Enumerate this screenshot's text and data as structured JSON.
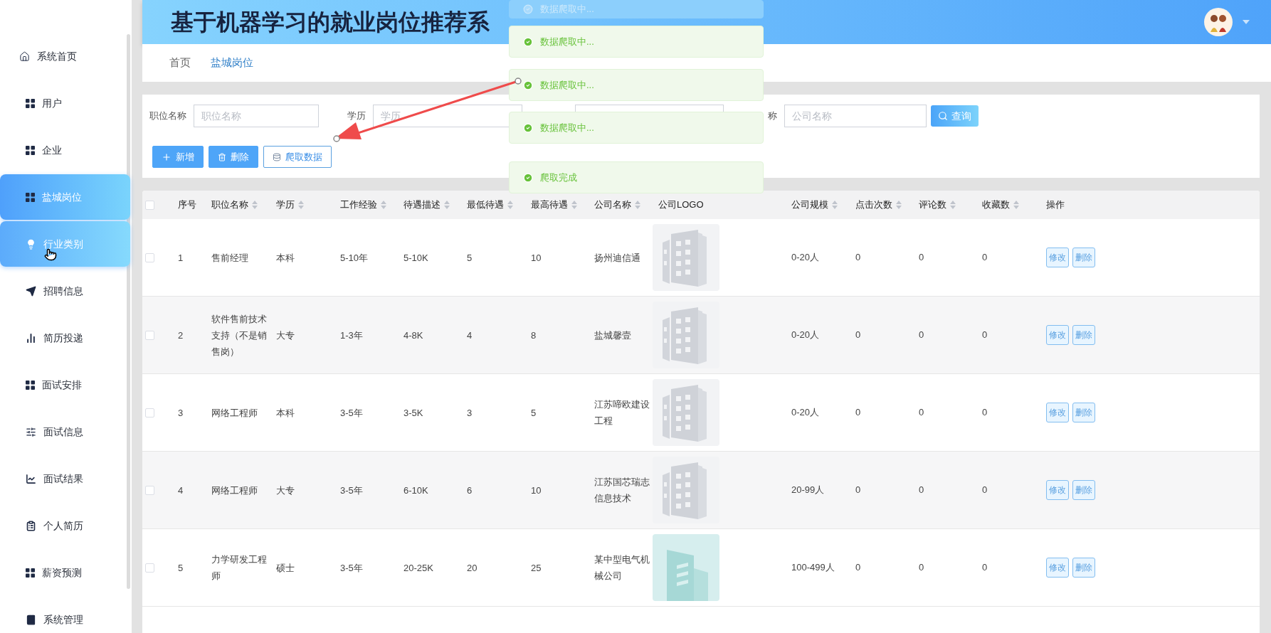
{
  "header": {
    "title": "基于机器学习的就业岗位推荐系"
  },
  "sidebar": {
    "items": [
      {
        "label": "系统首页",
        "kind": "home",
        "selected": false,
        "hovered": false
      },
      {
        "label": "用户",
        "kind": "grid",
        "selected": false,
        "hovered": false
      },
      {
        "label": "企业",
        "kind": "grid",
        "selected": false,
        "hovered": false
      },
      {
        "label": "盐城岗位",
        "kind": "grid",
        "selected": true,
        "hovered": false
      },
      {
        "label": "行业类别",
        "kind": "bulb",
        "selected": false,
        "hovered": true
      },
      {
        "label": "招聘信息",
        "kind": "send",
        "selected": false,
        "hovered": false
      },
      {
        "label": "简历投递",
        "kind": "bars",
        "selected": false,
        "hovered": false
      },
      {
        "label": "面试安排",
        "kind": "grid",
        "selected": false,
        "hovered": false
      },
      {
        "label": "面试信息",
        "kind": "sliders",
        "selected": false,
        "hovered": false
      },
      {
        "label": "面试结果",
        "kind": "chart",
        "selected": false,
        "hovered": false
      },
      {
        "label": "个人简历",
        "kind": "clipboard",
        "selected": false,
        "hovered": false
      },
      {
        "label": "薪资预测",
        "kind": "grid",
        "selected": false,
        "hovered": false
      },
      {
        "label": "系统管理",
        "kind": "book",
        "selected": false,
        "hovered": false
      }
    ]
  },
  "breadcrumb": [
    {
      "label": "首页",
      "selected": false
    },
    {
      "label": "盐城岗位",
      "selected": true
    }
  ],
  "search": {
    "fields": [
      {
        "kind": "input",
        "label": "职位名称",
        "placeholder": "职位名称"
      },
      {
        "kind": "input",
        "label": "学历",
        "placeholder": "学历"
      },
      {
        "kind": "covered"
      },
      {
        "kind": "input",
        "label": "称",
        "placeholder": "公司名称"
      }
    ],
    "button": "查询"
  },
  "actions": [
    {
      "kind": "add",
      "label": "新增"
    },
    {
      "kind": "delete",
      "label": "删除"
    },
    {
      "kind": "crawl",
      "label": "爬取数据"
    }
  ],
  "table": {
    "header_checkbox": {
      "checked": false
    },
    "columns": [
      {
        "label": "序号",
        "sortable": false
      },
      {
        "label": "职位名称",
        "sortable": true
      },
      {
        "label": "学历",
        "sortable": true
      },
      {
        "label": "工作经验",
        "sortable": true
      },
      {
        "label": "待遇描述",
        "sortable": true
      },
      {
        "label": "最低待遇",
        "sortable": true
      },
      {
        "label": "最高待遇",
        "sortable": true
      },
      {
        "label": "公司名称",
        "sortable": true
      },
      {
        "label": "公司LOGO",
        "sortable": false
      },
      {
        "label": "公司规模",
        "sortable": true
      },
      {
        "label": "点击次数",
        "sortable": true
      },
      {
        "label": "评论数",
        "sortable": true
      },
      {
        "label": "收藏数",
        "sortable": true
      },
      {
        "label": "操作",
        "sortable": false
      }
    ],
    "rows": [
      {
        "checked": false,
        "cells": [
          "1",
          "售前经理",
          "本科",
          "5-10年",
          "5-10K",
          "5",
          "10",
          "扬州迪信通"
        ],
        "logo": {
          "kind": "default"
        },
        "tail": [
          "0-20人",
          "0",
          "0",
          "0"
        ],
        "actions": [
          "修改",
          "删除"
        ]
      },
      {
        "checked": false,
        "cells": [
          "2",
          "软件售前技术支持（不是销售岗）",
          "大专",
          "1-3年",
          "4-8K",
          "4",
          "8",
          "盐城馨壹"
        ],
        "logo": {
          "kind": "default"
        },
        "tail": [
          "0-20人",
          "0",
          "0",
          "0"
        ],
        "actions": [
          "修改",
          "删除"
        ]
      },
      {
        "checked": false,
        "cells": [
          "3",
          "网络工程师",
          "本科",
          "3-5年",
          "3-5K",
          "3",
          "5",
          "江苏啼欧建设工程"
        ],
        "logo": {
          "kind": "default"
        },
        "tail": [
          "0-20人",
          "0",
          "0",
          "0"
        ],
        "actions": [
          "修改",
          "删除"
        ]
      },
      {
        "checked": false,
        "cells": [
          "4",
          "网络工程师",
          "大专",
          "3-5年",
          "6-10K",
          "6",
          "10",
          "江苏国芯瑞志信息技术"
        ],
        "logo": {
          "kind": "default"
        },
        "tail": [
          "20-99人",
          "0",
          "0",
          "0"
        ],
        "actions": [
          "修改",
          "删除"
        ]
      },
      {
        "checked": false,
        "cells": [
          "5",
          "力学研发工程师",
          "硕士",
          "3-5年",
          "20-25K",
          "20",
          "25",
          "某中型电气机械公司"
        ],
        "logo": {
          "kind": "custom"
        },
        "tail": [
          "100-499人",
          "0",
          "0",
          "0"
        ],
        "actions": [
          "修改",
          "删除"
        ]
      }
    ]
  },
  "toasts": [
    {
      "kind": "leaving",
      "text": "数据爬取中..."
    },
    {
      "kind": "shown",
      "text": "数据爬取中..."
    },
    {
      "kind": "shown",
      "text": "数据爬取中..."
    },
    {
      "kind": "shown",
      "text": "数据爬取中..."
    },
    {
      "kind": "shown",
      "text": "爬取完成"
    }
  ]
}
